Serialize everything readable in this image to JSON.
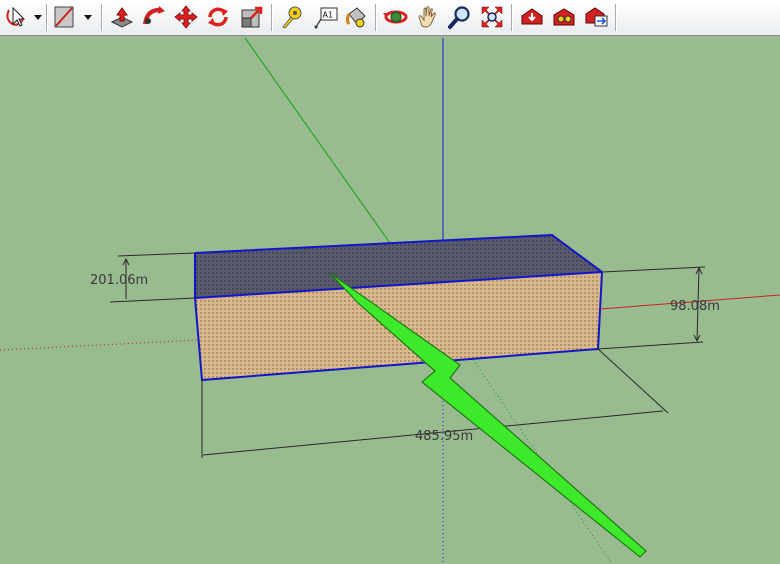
{
  "toolbar": {
    "tools": [
      {
        "name": "select-tool",
        "icon": "lasso-arrow-icon",
        "has_dropdown": true
      },
      {
        "name": "eraser-tool",
        "icon": "rectangle-eraser-icon",
        "has_dropdown": true
      },
      {
        "name": "push-pull-tool",
        "icon": "push-pull-icon"
      },
      {
        "name": "follow-me-tool",
        "icon": "follow-me-icon"
      },
      {
        "name": "move-tool",
        "icon": "move-arrows-icon"
      },
      {
        "name": "rotate-tool",
        "icon": "rotate-icon"
      },
      {
        "name": "scale-tool",
        "icon": "scale-icon"
      },
      {
        "name": "tape-measure-tool",
        "icon": "tape-measure-icon"
      },
      {
        "name": "text-tool",
        "icon": "text-label-icon",
        "label": "A1"
      },
      {
        "name": "paint-bucket-tool",
        "icon": "paint-bucket-icon"
      },
      {
        "name": "orbit-tool",
        "icon": "orbit-icon"
      },
      {
        "name": "pan-tool",
        "icon": "hand-icon"
      },
      {
        "name": "zoom-tool",
        "icon": "magnifier-icon"
      },
      {
        "name": "zoom-extents-tool",
        "icon": "zoom-extents-icon"
      },
      {
        "name": "get-models-tool",
        "icon": "warehouse-icon"
      },
      {
        "name": "components-tool",
        "icon": "components-icon"
      },
      {
        "name": "share-model-tool",
        "icon": "share-model-icon"
      }
    ]
  },
  "colors": {
    "background": "#98bb8f",
    "top_face": "#585a6e",
    "front_face": "#d9b98c",
    "selection_edge": "#1515c8",
    "axis_red": "#c82020",
    "axis_green": "#1aa01a",
    "axis_blue": "#1a1ae0",
    "arrow_green": "#3ee82a"
  },
  "dimensions": {
    "height_left": "201.06m",
    "height_right": "98.08m",
    "length": "485.95m"
  }
}
